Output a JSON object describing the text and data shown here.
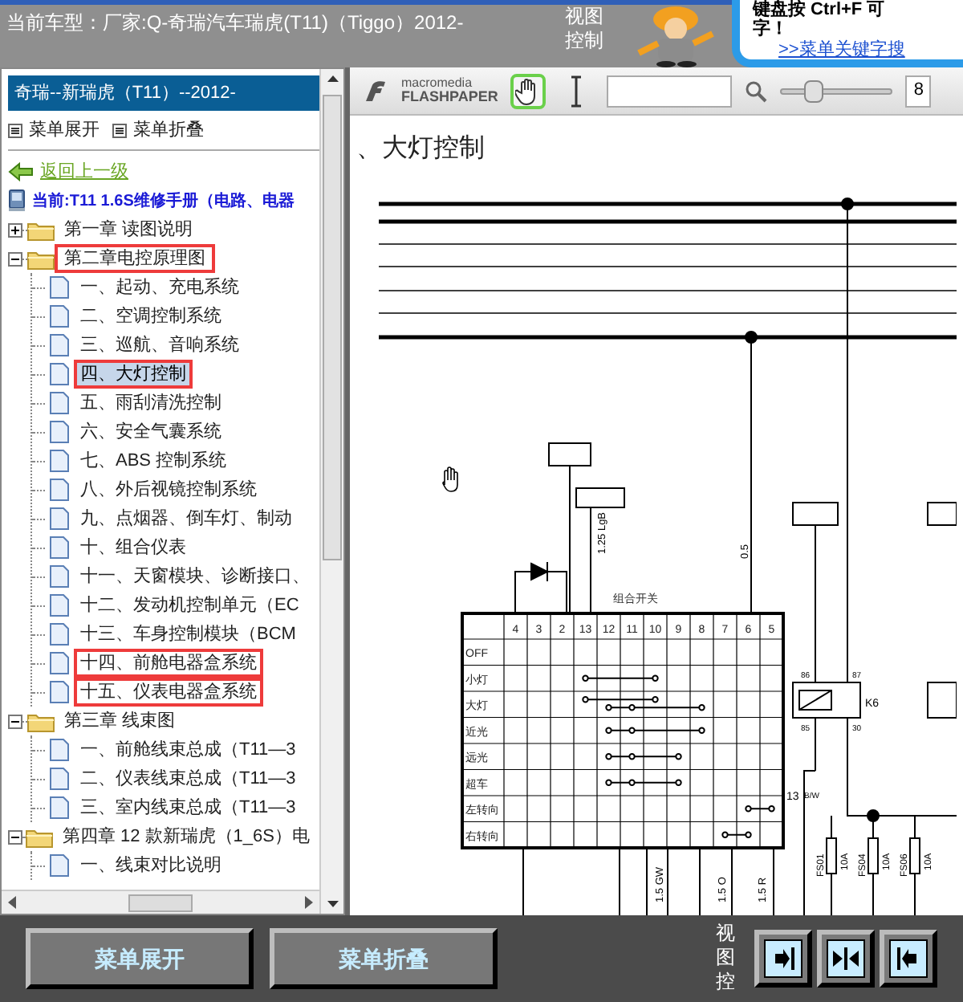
{
  "header": {
    "vehicle": "当前车型：厂家:Q-奇瑞汽车瑞虎(T11)（Tiggo）2012-",
    "view_control": "视图控制"
  },
  "ad": {
    "lines": [
      "键盘按 Ctrl+F 可",
      "字！"
    ],
    "link": ">>菜单关键字搜"
  },
  "sidebar": {
    "title": "奇瑞--新瑞虎（T11）--2012-",
    "actions": [
      "菜单展开",
      "菜单折叠"
    ],
    "back": "返回上一级",
    "current": "当前:T11 1.6S维修手册（电路、电器",
    "tree": [
      {
        "label": "第一章 读图说明",
        "expanded": false,
        "marked": false
      },
      {
        "label": "第二章电控原理图",
        "expanded": true,
        "marked": true,
        "children": [
          {
            "label": "一、起动、充电系统",
            "selected": false,
            "marked": false
          },
          {
            "label": "二、空调控制系统",
            "selected": false,
            "marked": false
          },
          {
            "label": "三、巡航、音响系统",
            "selected": false,
            "marked": false
          },
          {
            "label": "四、大灯控制",
            "selected": true,
            "marked": true
          },
          {
            "label": "五、雨刮清洗控制",
            "selected": false,
            "marked": false
          },
          {
            "label": "六、安全气囊系统",
            "selected": false,
            "marked": false
          },
          {
            "label": "七、ABS 控制系统",
            "selected": false,
            "marked": false
          },
          {
            "label": "八、外后视镜控制系统",
            "selected": false,
            "marked": false
          },
          {
            "label": "九、点烟器、倒车灯、制动",
            "selected": false,
            "marked": false
          },
          {
            "label": "十、组合仪表",
            "selected": false,
            "marked": false
          },
          {
            "label": "十一、天窗模块、诊断接口、",
            "selected": false,
            "marked": false
          },
          {
            "label": "十二、发动机控制单元（EC",
            "selected": false,
            "marked": false
          },
          {
            "label": "十三、车身控制模块（BCM",
            "selected": false,
            "marked": false
          },
          {
            "label": "十四、前舱电器盒系统",
            "selected": false,
            "marked": true
          },
          {
            "label": "十五、仪表电器盒系统",
            "selected": false,
            "marked": true
          }
        ]
      },
      {
        "label": "第三章 线束图",
        "expanded": true,
        "marked": false,
        "children": [
          {
            "label": "一、前舱线束总成（T11—3",
            "selected": false,
            "marked": false
          },
          {
            "label": "二、仪表线束总成（T11—3",
            "selected": false,
            "marked": false
          },
          {
            "label": "三、室内线束总成（T11—3",
            "selected": false,
            "marked": false
          }
        ]
      },
      {
        "label": "第四章 12 款新瑞虎（1_6S）电",
        "expanded": true,
        "marked": false,
        "children": [
          {
            "label": "一、线束对比说明",
            "selected": false,
            "marked": false
          }
        ]
      }
    ]
  },
  "viewer": {
    "logo_top": "macromedia",
    "logo_bottom": "FLASHPAPER",
    "tools": [
      {
        "kind": "hand",
        "selected": true
      },
      {
        "kind": "text",
        "selected": false
      }
    ],
    "zoom": {
      "level": 0.3,
      "value": "8"
    }
  },
  "document": {
    "title": "、大灯控制",
    "switch_title": "组合开关",
    "columns": [
      "4",
      "3",
      "2",
      "13",
      "12",
      "11",
      "10",
      "9",
      "8",
      "7",
      "6",
      "5"
    ],
    "rows": [
      "OFF",
      "小灯",
      "大灯",
      "近光",
      "远光",
      "超车",
      "左转向",
      "右转向"
    ],
    "wire_labels": [
      "1.25 LgB",
      "0.5",
      "1.5 GW",
      "1.5 O",
      "1.5 R"
    ],
    "relay": "K6",
    "pins": [
      "86",
      "87",
      "85",
      "30"
    ],
    "junction": "13",
    "junction_wire": "B/W",
    "fuses": [
      {
        "name": "FS01",
        "rating": "10A"
      },
      {
        "name": "FS04",
        "rating": "10A"
      },
      {
        "name": "FS06",
        "rating": "10A"
      }
    ]
  },
  "footer": {
    "buttons": [
      "菜单展开",
      "菜单折叠"
    ],
    "view_label": "视图控",
    "view_buttons": [
      {
        "kind": "show-right"
      },
      {
        "kind": "split"
      },
      {
        "kind": "show-left"
      }
    ]
  }
}
